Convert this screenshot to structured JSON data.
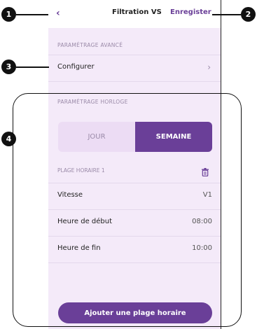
{
  "header": {
    "back_label": "‹",
    "title": "Filtration VS",
    "save_label": "Enregister"
  },
  "advanced": {
    "section_label": "PARAMÉTRAGE AVANCÉ",
    "configure_label": "Configurer",
    "configure_chevron": "›"
  },
  "clock": {
    "section_label": "PARAMÉTRAGE HORLOGE",
    "tabs": {
      "day": "JOUR",
      "week": "SEMAINE",
      "selected": "SEMAINE"
    },
    "slot": {
      "title": "PLAGE HORAIRE 1",
      "speed_label": "Vitesse",
      "speed_value": "V1",
      "start_label": "Heure de début",
      "start_value": "08:00",
      "end_label": "Heure de fin",
      "end_value": "10:00"
    },
    "add_button": "Ajouter une plage horaire"
  },
  "callouts": {
    "c1": "1",
    "c2": "2",
    "c3": "3",
    "c4": "4"
  },
  "colors": {
    "accent": "#6a3f98",
    "background": "#f4eaf9"
  },
  "icons": {
    "back": "chevron-left-icon",
    "configure": "chevron-right-icon",
    "delete": "trash-icon"
  }
}
